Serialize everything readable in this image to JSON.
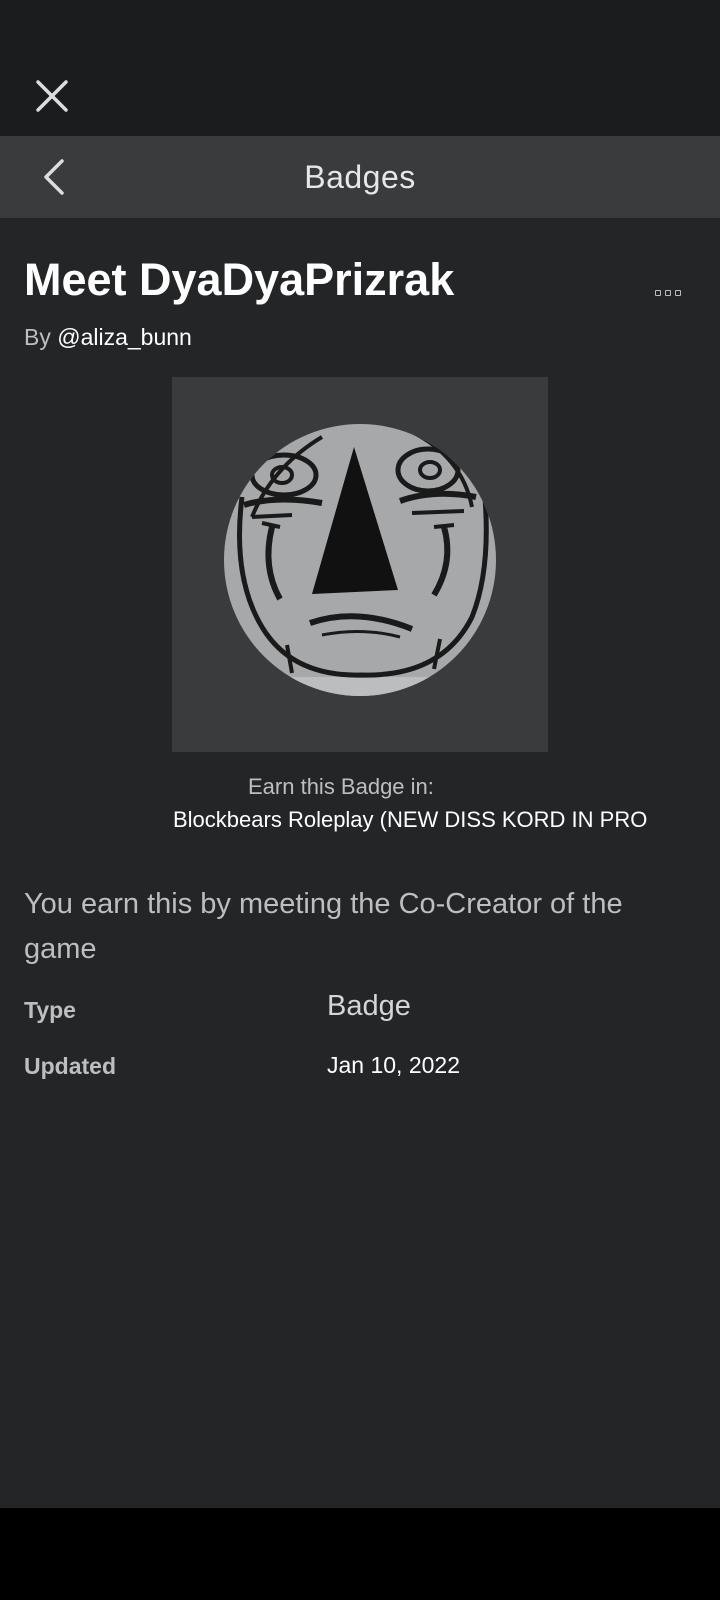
{
  "header": {
    "close_icon": "close-icon",
    "back_icon": "chevron-left-icon",
    "title": "Badges"
  },
  "badge": {
    "name": "Meet DyaDyaPrizrak",
    "by_prefix": "By",
    "creator": "@aliza_bunn",
    "more_icon": "more-options-icon",
    "thumbnail_icon": "badge-face-image",
    "earn_label": "Earn this Badge in:",
    "earn_game": "Blockbears Roleplay (NEW DISS KORD IN PRO",
    "description": "You earn this by meeting the Co-Creator of the game"
  },
  "details": {
    "type_label": "Type",
    "type_value": "Badge",
    "updated_label": "Updated",
    "updated_value": "Jan 10, 2022"
  },
  "colors": {
    "background": "#232527",
    "nav_bar": "#393b3d",
    "top_strip": "#1b1c1e",
    "muted_text": "#bdbebe"
  }
}
